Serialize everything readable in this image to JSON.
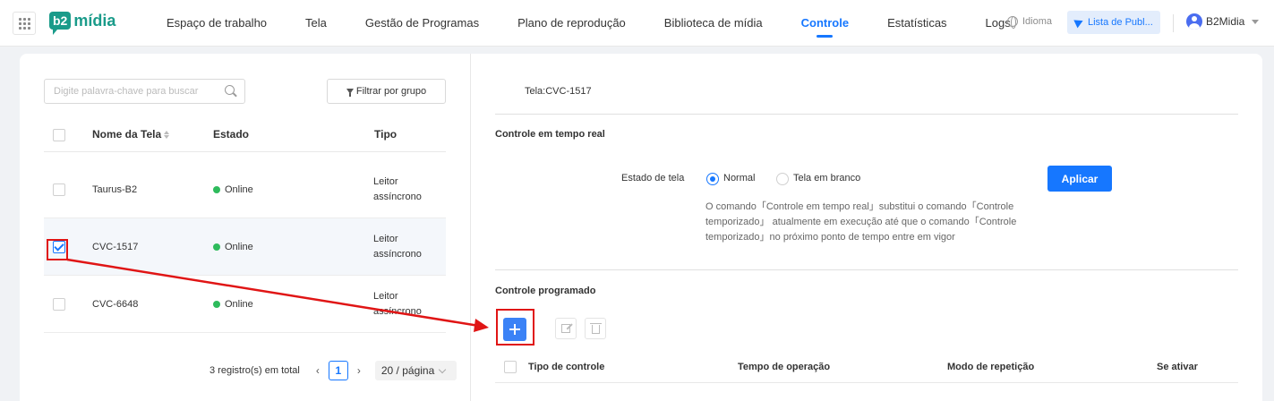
{
  "header": {
    "logo_badge": "b2",
    "logo_text": "mídia",
    "nav": [
      {
        "label": "Espaço de trabalho",
        "active": false
      },
      {
        "label": "Tela",
        "active": false
      },
      {
        "label": "Gestão de Programas",
        "active": false
      },
      {
        "label": "Plano de reprodução",
        "active": false
      },
      {
        "label": "Biblioteca de mídia",
        "active": false
      },
      {
        "label": "Controle",
        "active": true
      },
      {
        "label": "Estatísticas",
        "active": false
      },
      {
        "label": "Logs",
        "active": false
      }
    ],
    "language_label": "Idioma",
    "publish_label": "Lista de Publ...",
    "user_name": "B2Midia"
  },
  "screen_list": {
    "search_placeholder": "Digite palavra-chave para buscar",
    "filter_label": "Filtrar por grupo",
    "columns": {
      "name": "Nome da Tela",
      "status": "Estado",
      "type": "Tipo"
    },
    "rows": [
      {
        "name": "Taurus-B2",
        "status": "Online",
        "type": "Leitor assíncrono",
        "checked": false
      },
      {
        "name": "CVC-1517",
        "status": "Online",
        "type": "Leitor assíncrono",
        "checked": true
      },
      {
        "name": "CVC-6648",
        "status": "Online",
        "type": "Leitor assíncrono",
        "checked": false
      }
    ],
    "pagination": {
      "total_text": "3 registro(s) em total",
      "current_page": "1",
      "page_size": "20 / página"
    }
  },
  "control": {
    "screen_title": "Tela:CVC-1517",
    "realtime_title": "Controle em tempo real",
    "estado_label": "Estado de tela",
    "radio_normal": "Normal",
    "radio_blank": "Tela em branco",
    "selected_option": "Normal",
    "apply_label": "Aplicar",
    "note": "O comando「Controle em tempo real」substitui o comando「Controle temporizado」 atualmente em execução até que o comando「Controle temporizado」no próximo ponto de tempo entre em vigor",
    "scheduled_title": "Controle programado",
    "columns": {
      "control_type": "Tipo de controle",
      "operation_time": "Tempo de operação",
      "repeat_mode": "Modo de repetição",
      "active": "Se ativar"
    }
  },
  "colors": {
    "accent": "#1677ff",
    "brand": "#1a9b8a",
    "online": "#2ebb5c",
    "annotation": "#e01515"
  }
}
